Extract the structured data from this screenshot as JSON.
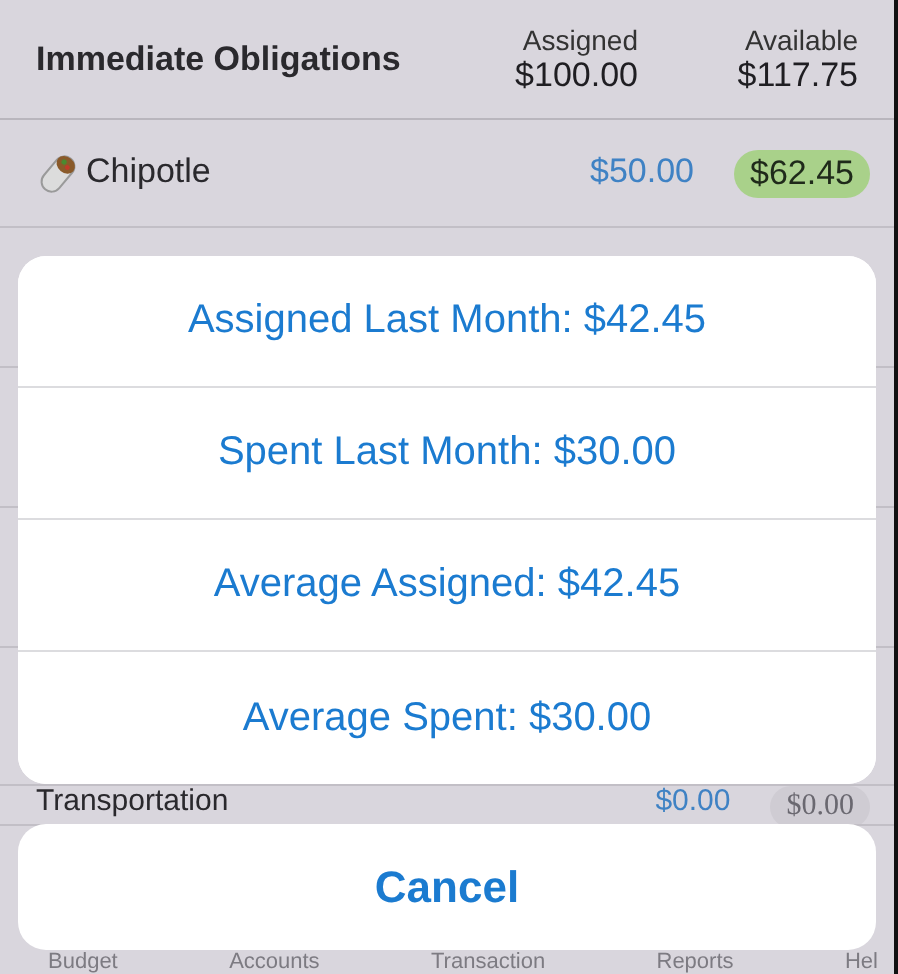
{
  "group": {
    "name": "Immediate Obligations",
    "assigned_label": "Assigned",
    "assigned": "$100.00",
    "available_label": "Available",
    "available": "$117.75"
  },
  "categories": [
    {
      "name": "Chipotle",
      "assigned": "$50.00",
      "available": "$62.45",
      "color": "#a9d18a"
    }
  ],
  "partial_row": {
    "name": "Transportation",
    "assigned": "$0.00",
    "available": "$0.00"
  },
  "action_sheet": {
    "options": [
      "Assigned Last Month: $42.45",
      "Spent Last Month: $30.00",
      "Average Assigned: $42.45",
      "Average Spent: $30.00"
    ],
    "cancel": "Cancel"
  },
  "tab_bar": [
    "Budget",
    "Accounts",
    "Transaction",
    "Reports",
    "Hel"
  ]
}
